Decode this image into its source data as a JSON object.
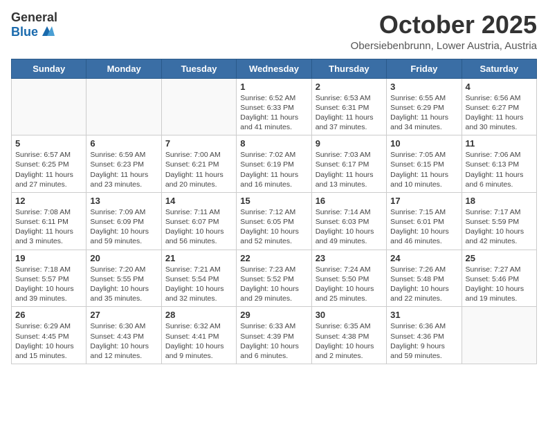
{
  "header": {
    "logo_general": "General",
    "logo_blue": "Blue",
    "month": "October 2025",
    "location": "Obersiebenbrunn, Lower Austria, Austria"
  },
  "days_of_week": [
    "Sunday",
    "Monday",
    "Tuesday",
    "Wednesday",
    "Thursday",
    "Friday",
    "Saturday"
  ],
  "weeks": [
    [
      {
        "day": "",
        "info": ""
      },
      {
        "day": "",
        "info": ""
      },
      {
        "day": "",
        "info": ""
      },
      {
        "day": "1",
        "info": "Sunrise: 6:52 AM\nSunset: 6:33 PM\nDaylight: 11 hours\nand 41 minutes."
      },
      {
        "day": "2",
        "info": "Sunrise: 6:53 AM\nSunset: 6:31 PM\nDaylight: 11 hours\nand 37 minutes."
      },
      {
        "day": "3",
        "info": "Sunrise: 6:55 AM\nSunset: 6:29 PM\nDaylight: 11 hours\nand 34 minutes."
      },
      {
        "day": "4",
        "info": "Sunrise: 6:56 AM\nSunset: 6:27 PM\nDaylight: 11 hours\nand 30 minutes."
      }
    ],
    [
      {
        "day": "5",
        "info": "Sunrise: 6:57 AM\nSunset: 6:25 PM\nDaylight: 11 hours\nand 27 minutes."
      },
      {
        "day": "6",
        "info": "Sunrise: 6:59 AM\nSunset: 6:23 PM\nDaylight: 11 hours\nand 23 minutes."
      },
      {
        "day": "7",
        "info": "Sunrise: 7:00 AM\nSunset: 6:21 PM\nDaylight: 11 hours\nand 20 minutes."
      },
      {
        "day": "8",
        "info": "Sunrise: 7:02 AM\nSunset: 6:19 PM\nDaylight: 11 hours\nand 16 minutes."
      },
      {
        "day": "9",
        "info": "Sunrise: 7:03 AM\nSunset: 6:17 PM\nDaylight: 11 hours\nand 13 minutes."
      },
      {
        "day": "10",
        "info": "Sunrise: 7:05 AM\nSunset: 6:15 PM\nDaylight: 11 hours\nand 10 minutes."
      },
      {
        "day": "11",
        "info": "Sunrise: 7:06 AM\nSunset: 6:13 PM\nDaylight: 11 hours\nand 6 minutes."
      }
    ],
    [
      {
        "day": "12",
        "info": "Sunrise: 7:08 AM\nSunset: 6:11 PM\nDaylight: 11 hours\nand 3 minutes."
      },
      {
        "day": "13",
        "info": "Sunrise: 7:09 AM\nSunset: 6:09 PM\nDaylight: 10 hours\nand 59 minutes."
      },
      {
        "day": "14",
        "info": "Sunrise: 7:11 AM\nSunset: 6:07 PM\nDaylight: 10 hours\nand 56 minutes."
      },
      {
        "day": "15",
        "info": "Sunrise: 7:12 AM\nSunset: 6:05 PM\nDaylight: 10 hours\nand 52 minutes."
      },
      {
        "day": "16",
        "info": "Sunrise: 7:14 AM\nSunset: 6:03 PM\nDaylight: 10 hours\nand 49 minutes."
      },
      {
        "day": "17",
        "info": "Sunrise: 7:15 AM\nSunset: 6:01 PM\nDaylight: 10 hours\nand 46 minutes."
      },
      {
        "day": "18",
        "info": "Sunrise: 7:17 AM\nSunset: 5:59 PM\nDaylight: 10 hours\nand 42 minutes."
      }
    ],
    [
      {
        "day": "19",
        "info": "Sunrise: 7:18 AM\nSunset: 5:57 PM\nDaylight: 10 hours\nand 39 minutes."
      },
      {
        "day": "20",
        "info": "Sunrise: 7:20 AM\nSunset: 5:55 PM\nDaylight: 10 hours\nand 35 minutes."
      },
      {
        "day": "21",
        "info": "Sunrise: 7:21 AM\nSunset: 5:54 PM\nDaylight: 10 hours\nand 32 minutes."
      },
      {
        "day": "22",
        "info": "Sunrise: 7:23 AM\nSunset: 5:52 PM\nDaylight: 10 hours\nand 29 minutes."
      },
      {
        "day": "23",
        "info": "Sunrise: 7:24 AM\nSunset: 5:50 PM\nDaylight: 10 hours\nand 25 minutes."
      },
      {
        "day": "24",
        "info": "Sunrise: 7:26 AM\nSunset: 5:48 PM\nDaylight: 10 hours\nand 22 minutes."
      },
      {
        "day": "25",
        "info": "Sunrise: 7:27 AM\nSunset: 5:46 PM\nDaylight: 10 hours\nand 19 minutes."
      }
    ],
    [
      {
        "day": "26",
        "info": "Sunrise: 6:29 AM\nSunset: 4:45 PM\nDaylight: 10 hours\nand 15 minutes."
      },
      {
        "day": "27",
        "info": "Sunrise: 6:30 AM\nSunset: 4:43 PM\nDaylight: 10 hours\nand 12 minutes."
      },
      {
        "day": "28",
        "info": "Sunrise: 6:32 AM\nSunset: 4:41 PM\nDaylight: 10 hours\nand 9 minutes."
      },
      {
        "day": "29",
        "info": "Sunrise: 6:33 AM\nSunset: 4:39 PM\nDaylight: 10 hours\nand 6 minutes."
      },
      {
        "day": "30",
        "info": "Sunrise: 6:35 AM\nSunset: 4:38 PM\nDaylight: 10 hours\nand 2 minutes."
      },
      {
        "day": "31",
        "info": "Sunrise: 6:36 AM\nSunset: 4:36 PM\nDaylight: 9 hours\nand 59 minutes."
      },
      {
        "day": "",
        "info": ""
      }
    ]
  ]
}
